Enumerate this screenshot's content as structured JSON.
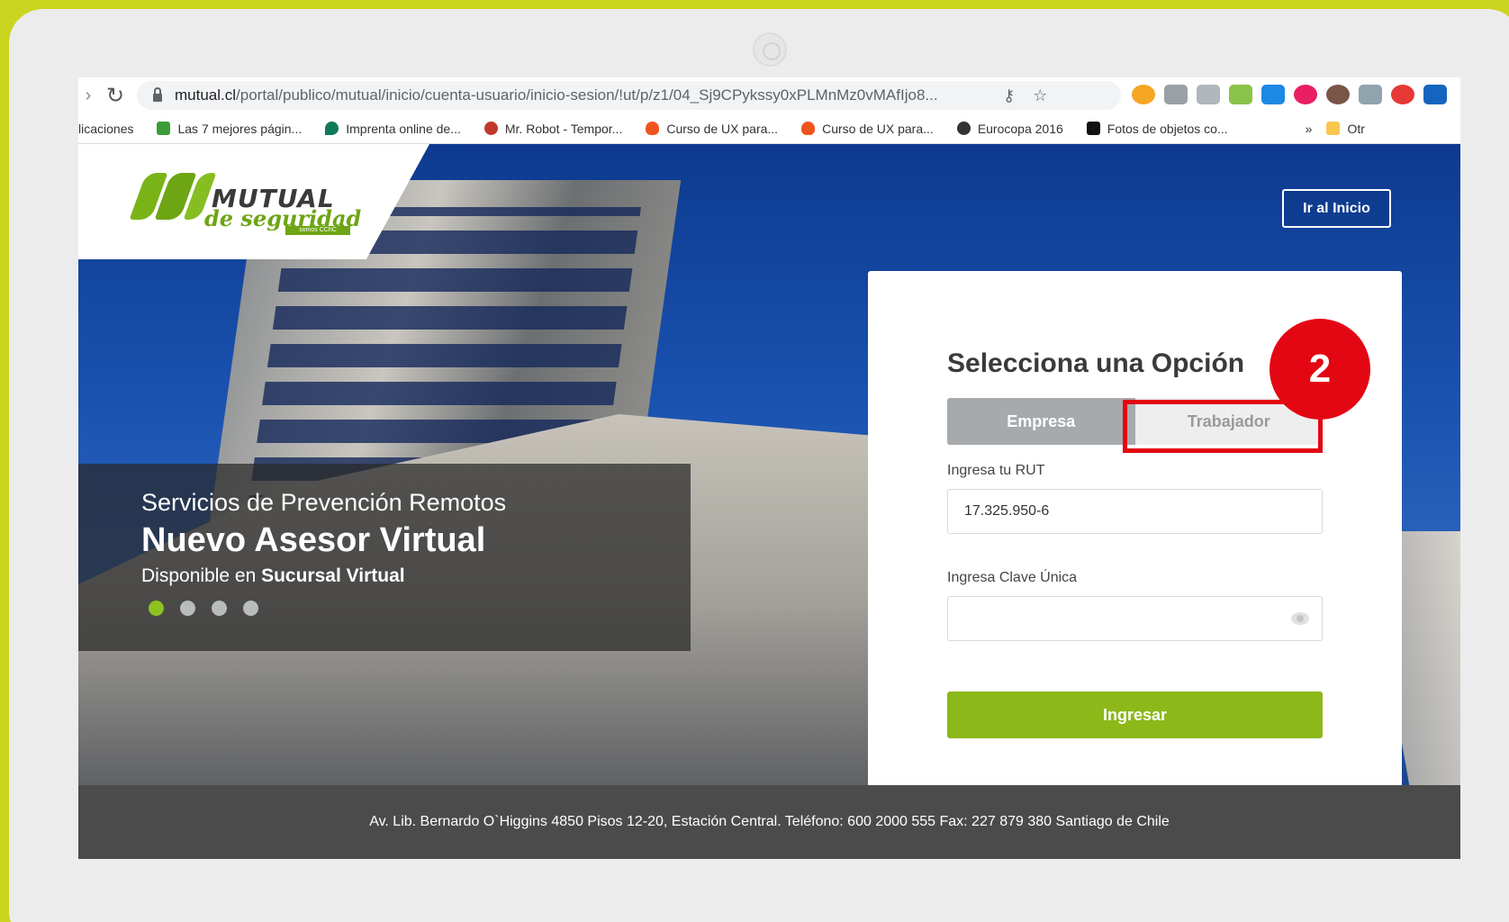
{
  "browser": {
    "url_host": "mutual.cl",
    "url_path": "/portal/publico/mutual/inicio/cuenta-usuario/inicio-sesion/!ut/p/z1/04_Sj9CPykssy0xPLMnMz0vMAfIjo8...",
    "bookmarks": [
      {
        "label": "licaciones",
        "color": "#ffffff"
      },
      {
        "label": "Las 7 mejores págin...",
        "color": "#3a9d3a"
      },
      {
        "label": "Imprenta online de...",
        "color": "#0f7a5a"
      },
      {
        "label": "Mr. Robot - Tempor...",
        "color": "#c0392b"
      },
      {
        "label": "Curso de UX para...",
        "color": "#f0541e"
      },
      {
        "label": "Curso de UX para...",
        "color": "#f0541e"
      },
      {
        "label": "Eurocopa 2016",
        "color": "#333333"
      },
      {
        "label": "Fotos de objetos co...",
        "color": "#111111"
      }
    ],
    "bookmarks_more": "»",
    "bookmarks_other": "Otr"
  },
  "site": {
    "logo_word": "MUTUAL",
    "logo_sub": "de seguridad",
    "logo_tag": "somos CChC",
    "ir_inicio": "Ir al Inicio",
    "banner": {
      "line1": "Servicios de Prevención Remotos",
      "line2": "Nuevo Asesor Virtual",
      "line3_prefix": "Disponible en ",
      "line3_bold": "Sucursal Virtual"
    },
    "login": {
      "title": "Selecciona una Opción",
      "tab_empresa": "Empresa",
      "tab_trabajador": "Trabajador",
      "rut_label": "Ingresa tu RUT",
      "rut_value": "17.325.950-6",
      "clave_label": "Ingresa Clave Única",
      "clave_value": "",
      "submit": "Ingresar"
    },
    "footer": "Av. Lib. Bernardo O`Higgins 4850 Pisos 12-20, Estación Central. Teléfono: 600 2000 555 Fax: 227 879 380 Santiago de Chile"
  },
  "annotation": {
    "step_number": "2",
    "color": "#e30613"
  },
  "colors": {
    "frame_background": "#cbd41e",
    "brand_green": "#8cb819",
    "footer": "#4b4b4b"
  }
}
